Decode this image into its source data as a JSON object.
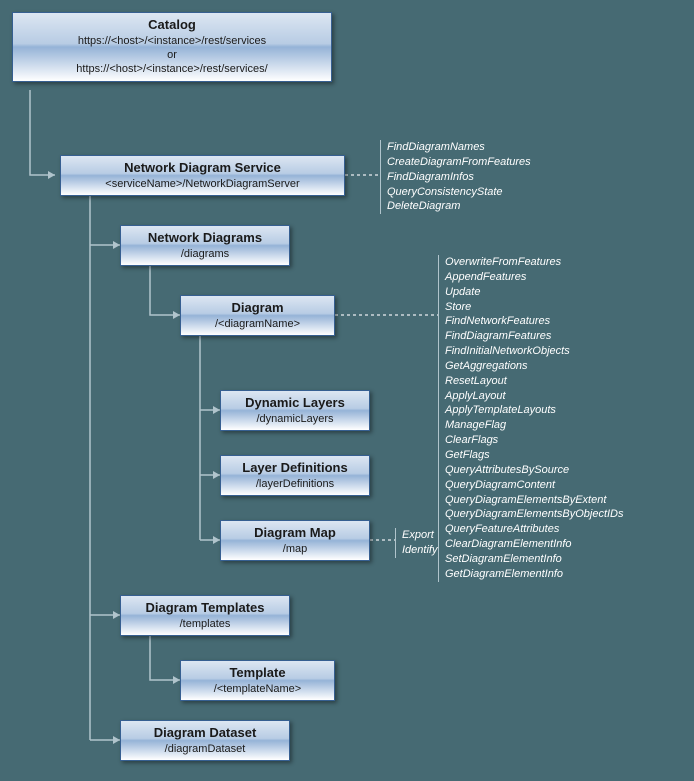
{
  "nodes": {
    "catalog": {
      "title": "Catalog",
      "line1": "https://<host>/<instance>/rest/services",
      "or": "or",
      "line2": "https://<host>/<instance>/rest/services/"
    },
    "nds": {
      "title": "Network Diagram Service",
      "path": "<serviceName>/NetworkDiagramServer"
    },
    "diagrams": {
      "title": "Network Diagrams",
      "path": "/diagrams"
    },
    "diagram": {
      "title": "Diagram",
      "path": "/<diagramName>"
    },
    "dynlayers": {
      "title": "Dynamic Layers",
      "path": "/dynamicLayers"
    },
    "layerdefs": {
      "title": "Layer Definitions",
      "path": "/layerDefinitions"
    },
    "map": {
      "title": "Diagram Map",
      "path": "/map"
    },
    "templates": {
      "title": "Diagram Templates",
      "path": "/templates"
    },
    "template": {
      "title": "Template",
      "path": "/<templateName>"
    },
    "dataset": {
      "title": "Diagram Dataset",
      "path": "/diagramDataset"
    }
  },
  "ops": {
    "nds": [
      "FindDiagramNames",
      "CreateDiagramFromFeatures",
      "FindDiagramInfos",
      "QueryConsistencyState",
      "DeleteDiagram"
    ],
    "diagram": [
      "OverwriteFromFeatures",
      "AppendFeatures",
      "Update",
      "Store",
      "FindNetworkFeatures",
      "FindDiagramFeatures",
      "FindInitialNetworkObjects",
      "GetAggregations",
      "ResetLayout",
      "ApplyLayout",
      "ApplyTemplateLayouts",
      "ManageFlag",
      "ClearFlags",
      "GetFlags",
      "QueryAttributesBySource",
      "QueryDiagramContent",
      "QueryDiagramElementsByExtent",
      "QueryDiagramElementsByObjectIDs",
      "QueryFeatureAttributes",
      "ClearDiagramElementInfo",
      "SetDiagramElementInfo",
      "GetDiagramElementInfo"
    ],
    "map": [
      "Export",
      "Identify"
    ]
  }
}
